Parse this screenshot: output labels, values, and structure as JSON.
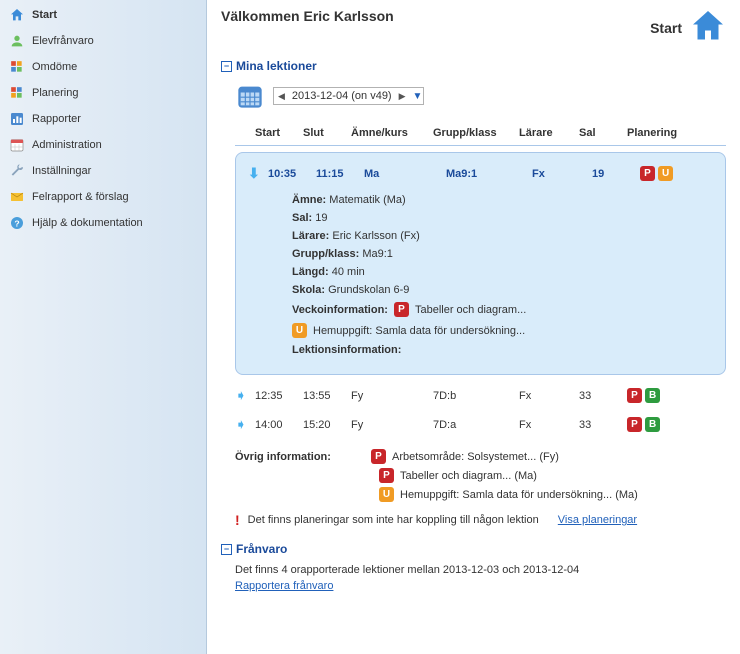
{
  "sidebar": {
    "items": [
      {
        "label": "Start",
        "active": true
      },
      {
        "label": "Elevfrånvaro"
      },
      {
        "label": "Omdöme"
      },
      {
        "label": "Planering"
      },
      {
        "label": "Rapporter"
      },
      {
        "label": "Administration"
      },
      {
        "label": "Inställningar"
      },
      {
        "label": "Felrapport & förslag"
      },
      {
        "label": "Hjälp & dokumentation"
      }
    ]
  },
  "header": {
    "welcome": "Välkommen Eric Karlsson",
    "start": "Start"
  },
  "sections": {
    "lessons_title": "Mina lektioner",
    "absence_title": "Frånvaro"
  },
  "date_picker": {
    "value": "2013-12-04 (on v49)"
  },
  "columns": {
    "start": "Start",
    "slut": "Slut",
    "amne": "Ämne/kurs",
    "grupp": "Grupp/klass",
    "larare": "Lärare",
    "sal": "Sal",
    "planering": "Planering"
  },
  "lessons": [
    {
      "start": "10:35",
      "slut": "11:15",
      "amne": "Ma",
      "grupp": "Ma9:1",
      "larare": "Fx",
      "sal": "19",
      "expanded": true,
      "details": {
        "amne_label": "Ämne:",
        "amne_val": "Matematik (Ma)",
        "sal_label": "Sal:",
        "sal_val": "19",
        "larare_label": "Lärare:",
        "larare_val": "Eric Karlsson (Fx)",
        "grupp_label": "Grupp/klass:",
        "grupp_val": "Ma9:1",
        "langd_label": "Längd:",
        "langd_val": "40 min",
        "skola_label": "Skola:",
        "skola_val": "Grundskolan 6-9",
        "veckinfo_label": "Veckoinformation:",
        "veck_p_text": "Tabeller och diagram...",
        "veck_u_text": "Hemuppgift: Samla data för undersökning...",
        "lektinfo_label": "Lektionsinformation:"
      }
    },
    {
      "start": "12:35",
      "slut": "13:55",
      "amne": "Fy",
      "grupp": "7D:b",
      "larare": "Fx",
      "sal": "33",
      "badges": [
        "p",
        "b"
      ]
    },
    {
      "start": "14:00",
      "slut": "15:20",
      "amne": "Fy",
      "grupp": "7D:a",
      "larare": "Fx",
      "sal": "33",
      "badges": [
        "p",
        "b"
      ]
    }
  ],
  "ovrig": {
    "label": "Övrig information:",
    "lines": [
      {
        "badge": "p",
        "text": "Arbetsområde: Solsystemet... (Fy)"
      },
      {
        "badge": "p",
        "text": "Tabeller och diagram... (Ma)"
      },
      {
        "badge": "u",
        "text": "Hemuppgift: Samla data för undersökning... (Ma)"
      }
    ]
  },
  "warning": {
    "text": "Det finns planeringar som inte har koppling till någon lektion",
    "link": "Visa planeringar"
  },
  "franvaro": {
    "text": "Det finns 4 orapporterade lektioner mellan 2013-12-03 och 2013-12-04",
    "link": "Rapportera frånvaro"
  }
}
